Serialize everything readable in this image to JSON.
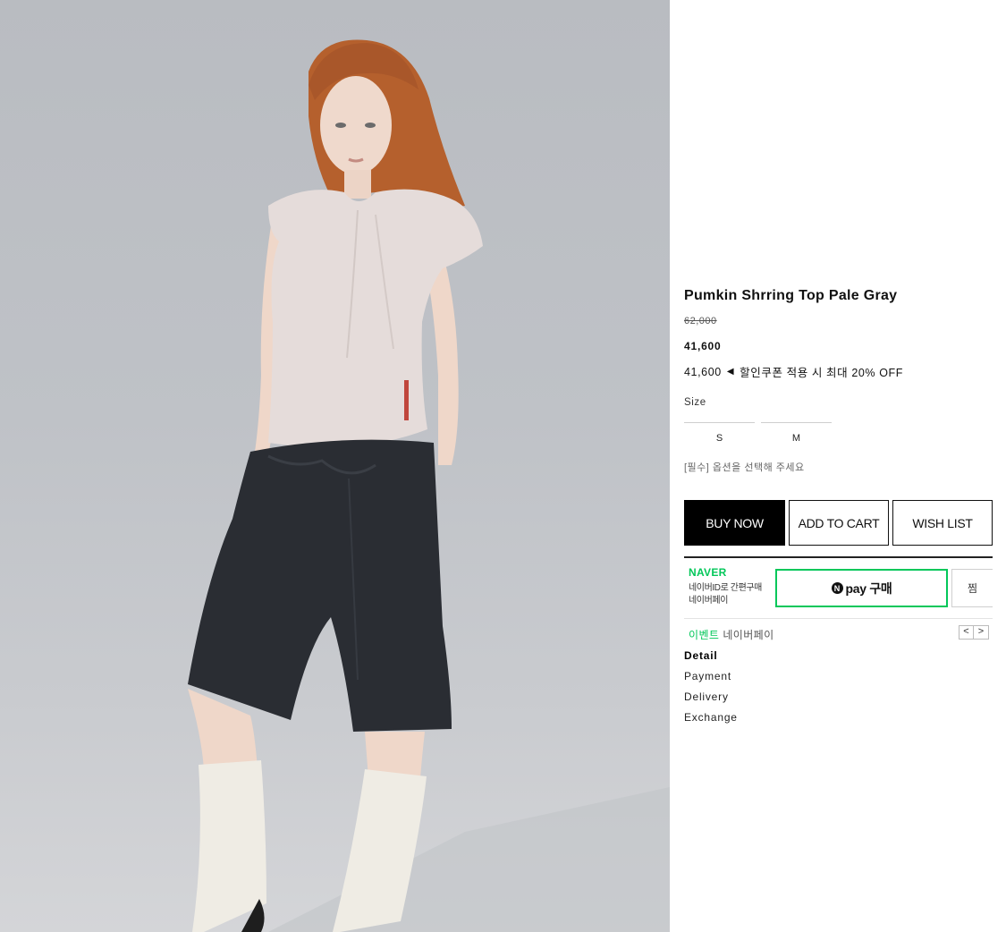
{
  "product": {
    "title": "Pumkin Shrring Top Pale Gray",
    "price_original": "62,000",
    "price_sale": "41,600",
    "coupon_price": "41,600",
    "coupon_arrow": "◀",
    "coupon_text": "할인쿠폰 적용 시 최대 20% OFF",
    "size_label": "Size",
    "size_options": [
      "S",
      "M"
    ],
    "required_message": "[필수] 옵션을 선택해 주세요"
  },
  "actions": {
    "buy_now": "BUY NOW",
    "add_to_cart": "ADD TO CART",
    "wish_list": "WISH LIST"
  },
  "npay": {
    "brand": "NAVER",
    "desc_line1": "네이버ID로 간편구매",
    "desc_line2": "네이버페이",
    "pay_logo": "N",
    "pay_label": "pay 구매",
    "zzim_label": "찜",
    "event_green": "이벤트",
    "event_gray": "네이버페이",
    "prev": "<",
    "next": ">"
  },
  "tabs": [
    "Detail",
    "Payment",
    "Delivery",
    "Exchange"
  ],
  "colors": {
    "naver_green": "#03c75a",
    "primary_button": "#000000",
    "photo_background": "#bfc2c7"
  },
  "icons": {
    "coupon_arrow": "left-triangle",
    "npay_logo": "naver-n-circle",
    "pager": [
      "chevron-left",
      "chevron-right"
    ]
  }
}
